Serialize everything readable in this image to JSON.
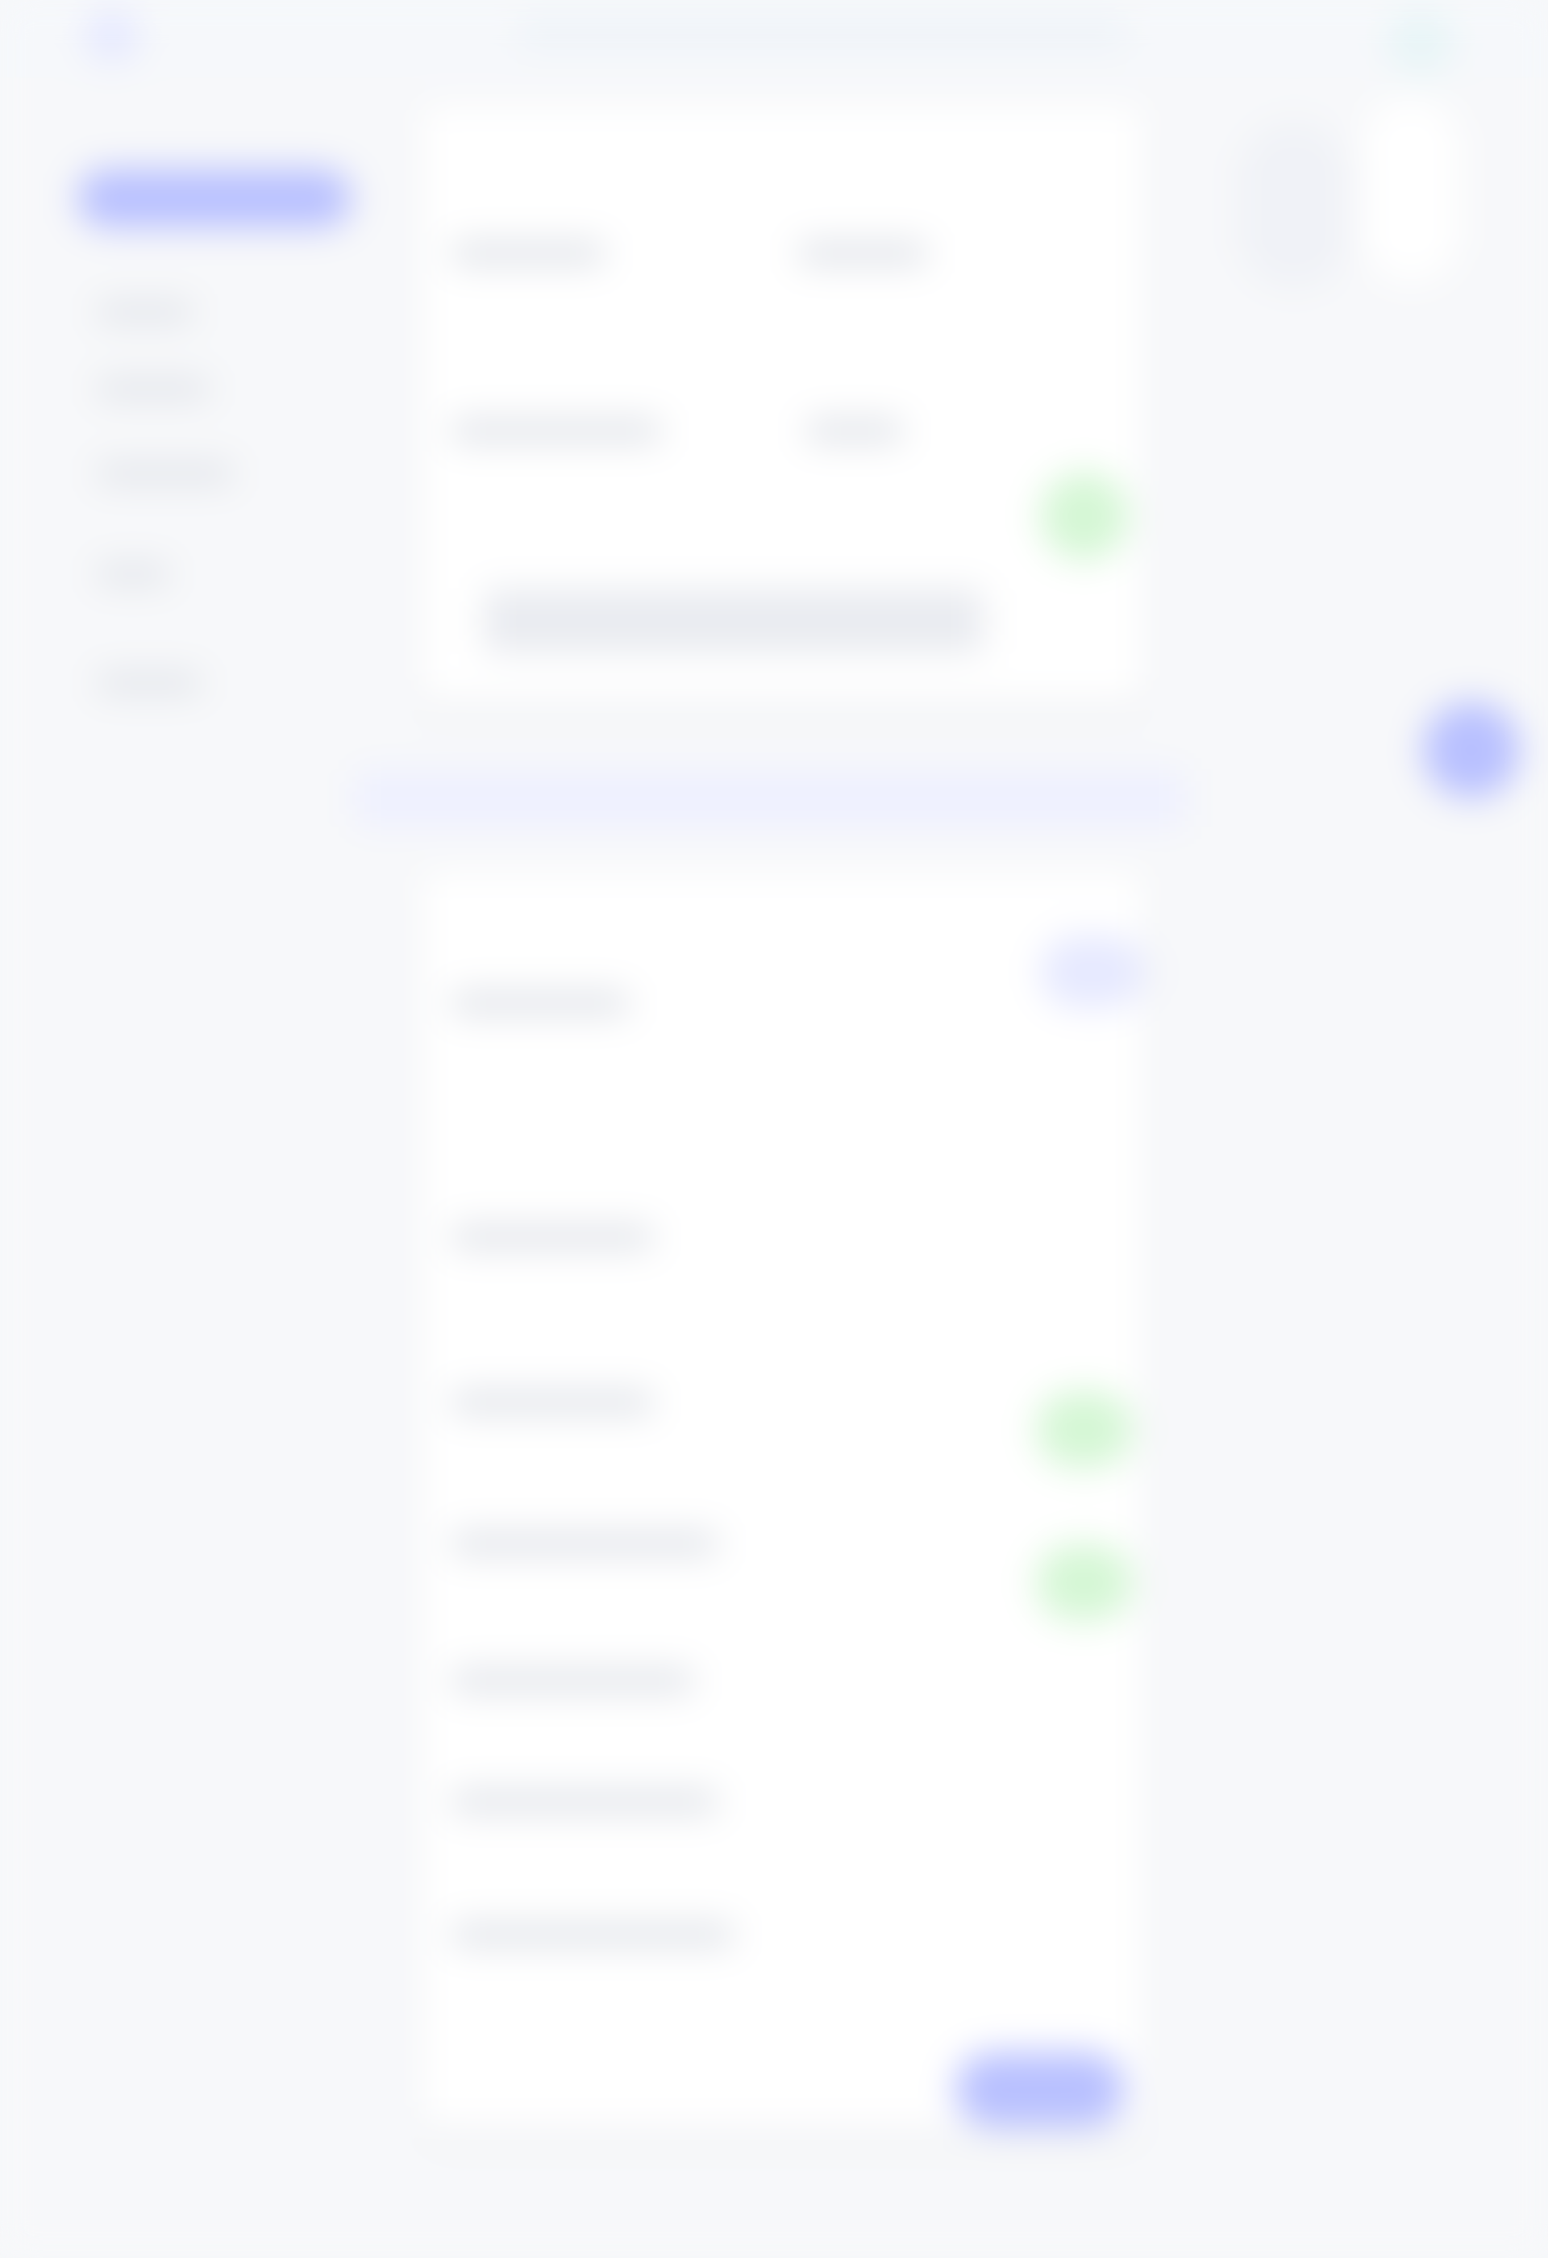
{
  "app": {
    "title": "",
    "search_placeholder": ""
  },
  "sidebar": {
    "active_item": "",
    "items": [
      {
        "label": ""
      },
      {
        "label": ""
      },
      {
        "label": ""
      },
      {
        "label": ""
      },
      {
        "label": ""
      }
    ]
  },
  "main": {
    "card1": {
      "title": "",
      "meta_left": "",
      "meta_right": "",
      "row_a": "",
      "row_b": "",
      "row_c": "",
      "status_button": ""
    },
    "banner": {
      "text": ""
    },
    "card2": {
      "title": "",
      "action_button": "",
      "section_1": "",
      "section_2": "",
      "section_3": "",
      "section_4": "",
      "section_5": "",
      "section_6": "",
      "primary_button": ""
    }
  },
  "rightcol": {
    "top_pill": "",
    "side_badge": "",
    "floating_button": ""
  },
  "colors": {
    "accent_blue": "#b8c0ff",
    "accent_green": "#d5f7d5",
    "surface": "#ffffff",
    "background": "#f7f8fa"
  }
}
